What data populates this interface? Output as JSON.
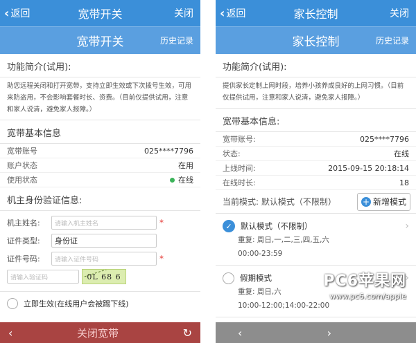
{
  "left": {
    "nav": {
      "back": "返回",
      "title": "宽带开关",
      "close": "关闭"
    },
    "subbar": {
      "title": "宽带开关",
      "history": "历史记录"
    },
    "intro": {
      "title": "功能简介(试用):",
      "text": "助您远程关闭和打开宽带，支持立即生效或下次拨号生效，可用来防盗用，不会影响套餐时长、资费。（目前仅提供试用，注意和家人说清，避免家人报障。）"
    },
    "broadband": {
      "title": "宽带基本信息",
      "rows": [
        {
          "label": "宽带账号",
          "value": "025****7796"
        },
        {
          "label": "账户状态",
          "value": "在用"
        },
        {
          "label": "使用状态",
          "value": "在线"
        }
      ]
    },
    "verify": {
      "title": "机主身份验证信息:",
      "name_label": "机主姓名:",
      "name_placeholder": "请输入机主姓名",
      "idtype_label": "证件类型:",
      "idtype_value": "身份证",
      "idno_label": "证件号码:",
      "idno_placeholder": "请输入证件号码",
      "captcha_placeholder": "请输入验证码",
      "captcha_text": "0L 68 6"
    },
    "immediate": "立即生效(在线用户会被踢下线)",
    "bottom": {
      "prev": "‹",
      "action": "关闭宽带",
      "refresh": "↻"
    }
  },
  "right": {
    "nav": {
      "back": "返回",
      "title": "家长控制",
      "close": "关闭"
    },
    "subbar": {
      "title": "家长控制",
      "history": "历史记录"
    },
    "intro": {
      "title": "功能简介(试用):",
      "text": "提供家长定制上网时段，培养小孩养成良好的上网习惯。（目前仅提供试用，注意和家人说清，避免家人报障。）"
    },
    "broadband": {
      "title": "宽带基本信息:",
      "rows": [
        {
          "label": "宽带账号:",
          "value": "025****7796"
        },
        {
          "label": "状态:",
          "value": "在线"
        },
        {
          "label": "上线时间:",
          "value": "2015-09-15 20:18:14"
        },
        {
          "label": "在线时长:",
          "value": "18"
        }
      ]
    },
    "mode": {
      "label": "当前模式: 默认模式（不限制）",
      "add_button": "新增模式"
    },
    "modes": [
      {
        "name": "默认模式（不限制）",
        "repeat": "重复: 周日,一,二,三,四,五,六",
        "time": "00:00-23:59"
      },
      {
        "name": "假期模式",
        "repeat": "重复: 周日,六",
        "time": "10:00-12:00;14:00-22:00"
      }
    ],
    "bottom": {
      "prev": "‹",
      "next": "›"
    }
  },
  "watermark": {
    "brand": "PC6苹果网",
    "url": "www.pc6.com/apple"
  },
  "colors": {
    "navbar": "#3b8fd9",
    "subbar": "#5a9fe0",
    "danger_bar": "#a94442",
    "online": "#3cb35a"
  }
}
